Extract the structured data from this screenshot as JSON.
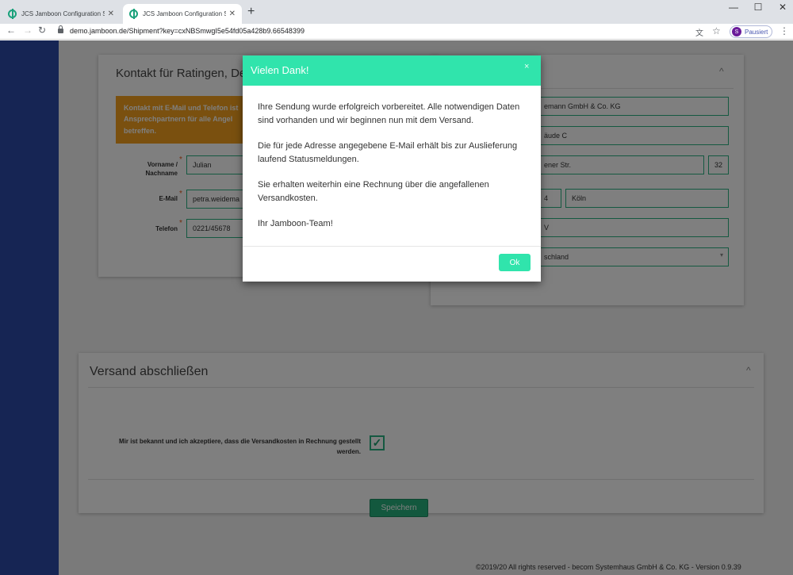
{
  "browser": {
    "tabs": [
      {
        "title": "JCS Jamboon Configuration Serv"
      },
      {
        "title": "JCS Jamboon Configuration Serv"
      }
    ],
    "new_tab": "+",
    "url": "demo.jamboon.de/Shipment?key=cxNBSmwgI5e54fd05a428b9.66548399",
    "profile_initial": "S",
    "profile_label": "Pausiert"
  },
  "contact_card": {
    "title": "Kontakt für Ratingen, Deu",
    "warning": "Kontakt mit E-Mail und Telefon ist Ansprechpartnern für alle Angel betreffen.",
    "fields": [
      {
        "label": "Vorname / Nachname",
        "value": "Julian"
      },
      {
        "label": "E-Mail",
        "value": "petra.weidema"
      },
      {
        "label": "Telefon",
        "value": "0221/45678"
      }
    ]
  },
  "address_card": {
    "fields": [
      {
        "value": "emann GmbH & Co. KG"
      },
      {
        "value": "äude C"
      },
      {
        "value": "ener Str."
      },
      {
        "value": "32"
      },
      {
        "value": "4"
      },
      {
        "value": "Köln"
      },
      {
        "value": "V"
      },
      {
        "value": "schland"
      }
    ]
  },
  "finish_card": {
    "title": "Versand abschließen",
    "consent": "Mir ist bekannt und ich akzeptiere, dass die Versandkosten in Rechnung gestellt werden.",
    "checkbox_mark": "✓",
    "save_label": "Speichern"
  },
  "footer": "©2019/20 All rights reserved - becom Systemhaus GmbH & Co. KG - Version 0.9.39",
  "modal": {
    "title": "Vielen Dank!",
    "close": "×",
    "paragraphs": [
      "Ihre Sendung wurde erfolgreich vorbereitet. Alle notwendigen Daten sind vorhanden und wir beginnen nun mit dem Versand.",
      "Die für jede Adresse angegebene E-Mail erhält bis zur Auslieferung laufend Statusmeldungen.",
      "Sie erhalten weiterhin eine Rechnung über die angefallenen Versandkosten.",
      "Ihr Jamboon-Team!"
    ],
    "ok_label": "Ok"
  },
  "colors": {
    "accent": "#30e4ac",
    "sidebar": "#2d4aa8",
    "warning": "#f4a01e",
    "input_border": "#2bb383"
  },
  "icons": [
    "back-arrow-icon",
    "forward-arrow-icon",
    "reload-icon",
    "lock-icon",
    "translate-icon",
    "star-icon",
    "menu-icon",
    "close-icon",
    "chevron-up-icon",
    "chevron-down-icon",
    "checkmark-icon"
  ]
}
